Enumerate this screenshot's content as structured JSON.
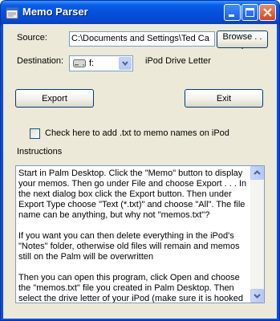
{
  "window": {
    "title": "Memo Parser"
  },
  "source": {
    "label": "Source:",
    "value": "C:\\Documents and Settings\\Ted Ca",
    "browse_label": "Browse . . ."
  },
  "destination": {
    "label": "Destination:",
    "selected_drive": "f:",
    "hint": "iPod Drive Letter"
  },
  "actions": {
    "export_label": "Export",
    "exit_label": "Exit"
  },
  "options": {
    "add_txt_label": "Check here to add .txt to memo names on iPod",
    "add_txt_checked": false
  },
  "instructions": {
    "label": "Instructions",
    "paragraphs": [
      "Start in Palm Desktop. Click the \"Memo\" button to display your memos. Then go under File and choose Export . . . In the next dialog box click the Export button. Then under Export Type choose \"Text (*.txt)\" and choose \"All\". The file name can be anything, but why not \"memos.txt\"?",
      "If you want you can then delete everything in the iPod's \"Notes\" folder, otherwise old files will remain and memos still on the Palm will be overwritten",
      "Then you can open this program, click Open and choose the \"memos.txt\" file you created in Palm Desktop. Then select the drive letter of your iPod (make sure it is hooked"
    ]
  },
  "colors": {
    "titlebar": "#0551dd",
    "client_bg": "#ece9d8",
    "close_button": "#d3461c"
  }
}
